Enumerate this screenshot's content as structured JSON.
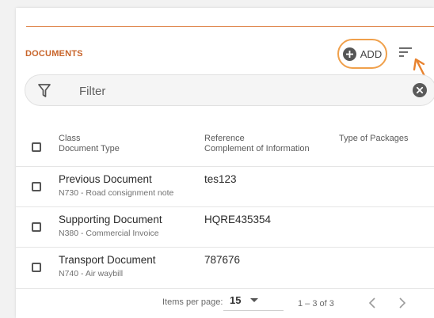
{
  "section": {
    "title": "DOCUMENTS",
    "add_label": "ADD",
    "accent_color": "#e08a52"
  },
  "filter": {
    "placeholder": "Filter",
    "value": ""
  },
  "table": {
    "headers": [
      {
        "main": "Class",
        "sub": "Document Type"
      },
      {
        "main": "Reference",
        "sub": "Complement of Information"
      },
      {
        "main": "Type of Packages",
        "sub": ""
      }
    ],
    "rows": [
      {
        "class": "Previous Document",
        "doc_type": "N730 - Road consignment note",
        "reference": "tes123"
      },
      {
        "class": "Supporting Document",
        "doc_type": "N380 - Commercial Invoice",
        "reference": "HQRE435354"
      },
      {
        "class": "Transport Document",
        "doc_type": "N740 - Air waybill",
        "reference": "787676"
      }
    ]
  },
  "pagination": {
    "items_per_page_label": "Items per page:",
    "items_per_page": "15",
    "range": "1 – 3 of 3"
  },
  "icons": {
    "add": "plus-circle-icon",
    "sort": "sort-lines-icon",
    "filter": "funnel-icon",
    "clear": "close-circle-icon",
    "prev": "chevron-left-icon",
    "next": "chevron-right-icon"
  }
}
